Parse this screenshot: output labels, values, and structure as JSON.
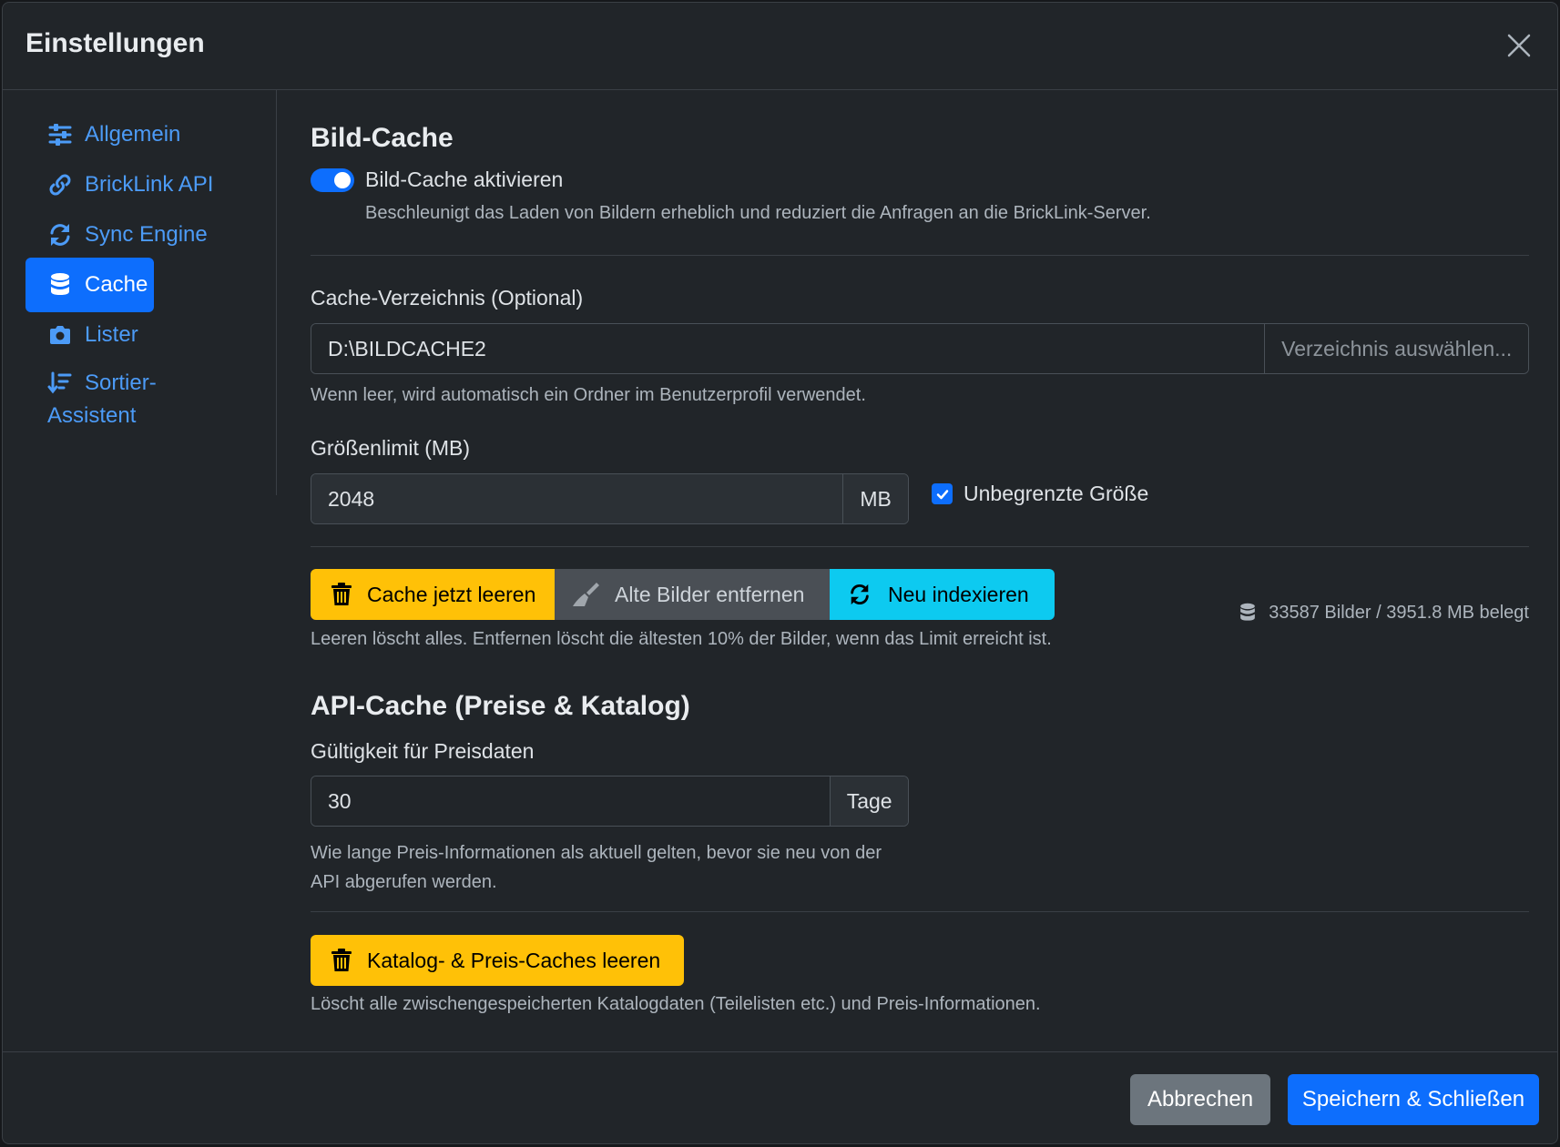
{
  "modal": {
    "title": "Einstellungen"
  },
  "sidebar": {
    "items": [
      {
        "label": "Allgemein",
        "icon": "sliders-icon"
      },
      {
        "label": "BrickLink API",
        "icon": "link-icon"
      },
      {
        "label": "Sync Engine",
        "icon": "sync-icon"
      },
      {
        "label": "Cache",
        "icon": "database-icon",
        "active": true
      },
      {
        "label": "Lister",
        "icon": "camera-icon"
      },
      {
        "label_line1": "Sortier-",
        "label_line2": "Assistent",
        "icon": "sort-icon"
      }
    ]
  },
  "image_cache": {
    "title": "Bild-Cache",
    "toggle_label": "Bild-Cache aktivieren",
    "toggle_on": true,
    "toggle_help": "Beschleunigt das Laden von Bildern erheblich und reduziert die Anfragen an die BrickLink-Server.",
    "dir_label": "Cache-Verzeichnis (Optional)",
    "dir_value": "D:\\BILDCACHE2",
    "dir_button": "Verzeichnis auswählen...",
    "dir_help": "Wenn leer, wird automatisch ein Ordner im Benutzerprofil verwendet.",
    "size_label": "Größenlimit (MB)",
    "size_value": "2048",
    "size_unit": "MB",
    "unlimited_label": "Unbegrenzte Größe",
    "unlimited_checked": true,
    "btn_clear": "Cache jetzt leeren",
    "btn_remove_old": "Alte Bilder entfernen",
    "btn_reindex": "Neu indexieren",
    "stats": "33587 Bilder / 3951.8 MB belegt",
    "actions_help": "Leeren löscht alles. Entfernen löscht die ältesten 10% der Bilder, wenn das Limit erreicht ist."
  },
  "api_cache": {
    "title": "API-Cache (Preise & Katalog)",
    "validity_label": "Gültigkeit für Preisdaten",
    "validity_value": "30",
    "validity_unit": "Tage",
    "validity_help_line1": "Wie lange Preis-Informationen als aktuell gelten, bevor sie neu von der",
    "validity_help_line2": "API abgerufen werden.",
    "btn_clear": "Katalog- & Preis-Caches leeren",
    "clear_help": "Löscht alle zwischengespeicherten Katalogdaten (Teilelisten etc.) und Preis-Informationen."
  },
  "footer": {
    "cancel": "Abbrechen",
    "save": "Speichern & Schließen"
  },
  "colors": {
    "primary": "#0d6efd",
    "warning": "#ffc107",
    "info": "#0dcaf0",
    "secondary": "#4a4f55",
    "background": "#212529"
  }
}
